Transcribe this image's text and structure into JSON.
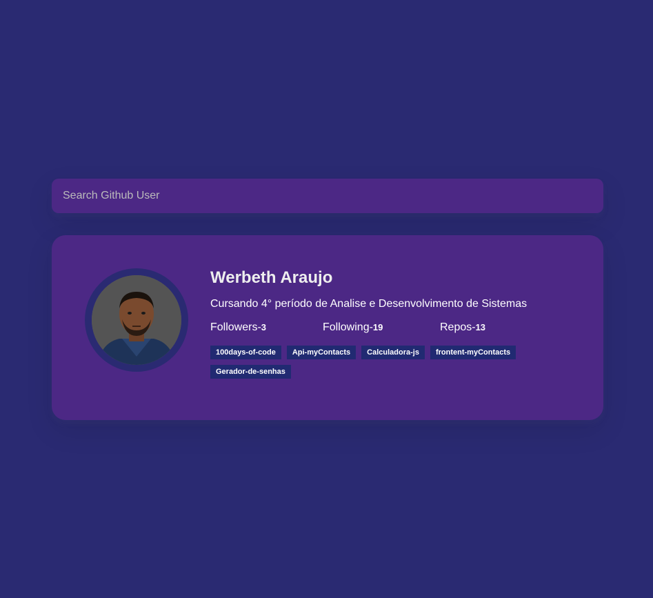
{
  "search": {
    "placeholder": "Search Github User",
    "value": ""
  },
  "profile": {
    "name": "Werbeth Araujo",
    "bio": "Cursando 4° período de Analise e Desenvolvimento de Sistemas",
    "stats": {
      "followers_label": "Followers-",
      "followers_value": "3",
      "following_label": "Following-",
      "following_value": "19",
      "repos_label": "Repos-",
      "repos_value": "13"
    },
    "repos": [
      "100days-of-code",
      "Api-myContacts",
      "Calculadora-js",
      "frontent-myContacts",
      "Gerador-de-senhas"
    ]
  },
  "colors": {
    "background": "#2a2a72",
    "card": "#4c2885",
    "repo_tag": "#212a72",
    "text": "#ffffff"
  }
}
